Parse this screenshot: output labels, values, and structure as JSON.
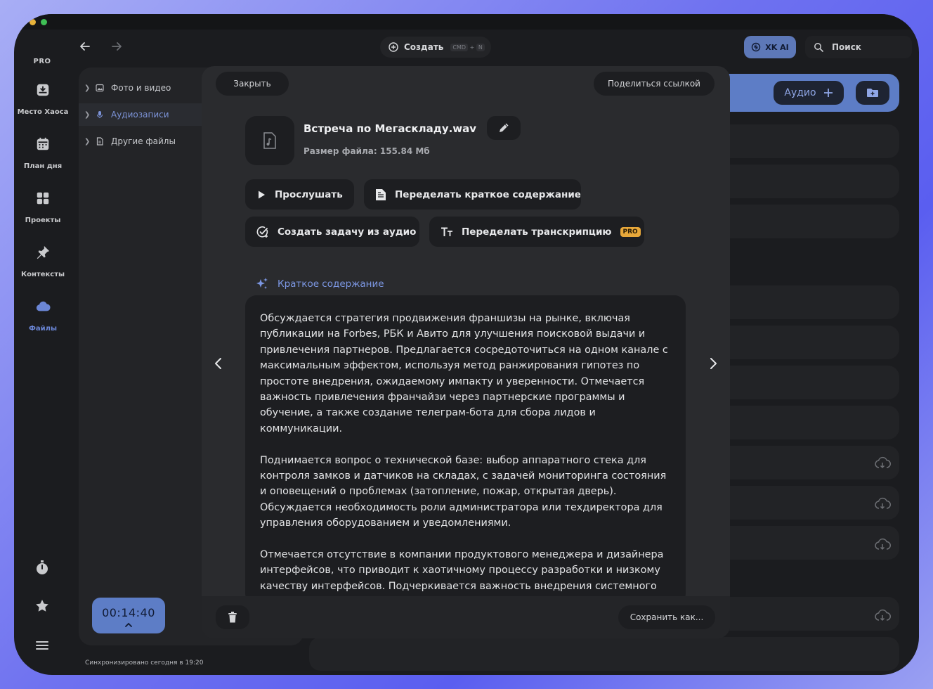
{
  "app": {
    "plan_label": "PRO",
    "nav": [
      {
        "label": "Место Хаоса",
        "icon": "inbox-tray-icon"
      },
      {
        "label": "План дня",
        "icon": "calendar-icon"
      },
      {
        "label": "Проекты",
        "icon": "grid-icon"
      },
      {
        "label": "Контексты",
        "icon": "pin-icon"
      },
      {
        "label": "Файлы",
        "icon": "cloud-icon",
        "active": true
      }
    ],
    "bottom_icons": [
      "stopwatch-icon",
      "star-icon",
      "menu-icon"
    ]
  },
  "topbar": {
    "create_label": "Создать",
    "shortcut": [
      "CMD",
      "+",
      "N"
    ],
    "ai_label": "XK AI",
    "search_placeholder": "Поиск"
  },
  "tree": {
    "items": [
      {
        "label": "Фото и видео",
        "icon": "image-icon"
      },
      {
        "label": "Аудиозаписи",
        "icon": "microphone-icon",
        "active": true
      },
      {
        "label": "Другие файлы",
        "icon": "document-icon"
      }
    ]
  },
  "list": {
    "audio_button": "Аудио"
  },
  "timer": {
    "value": "00:14:40"
  },
  "status": {
    "sync_text": "Синхронизировано сегодня в 19:20"
  },
  "modal": {
    "close_label": "Закрыть",
    "share_label": "Поделиться ссылкой",
    "file": {
      "name": "Встреча по Мегаскладу.wav",
      "size": "Размер файла: 155.84 Мб"
    },
    "actions": {
      "listen": "Прослушать",
      "redo_summary": "Переделать краткое содержание",
      "create_task": "Создать задачу из аудио",
      "redo_transcript": "Переделать транскрипцию",
      "pro_badge": "PRO"
    },
    "summary_title": "Краткое содержание",
    "summary_paragraphs": [
      "Обсуждается стратегия продвижения франшизы на рынке, включая публикации на Forbes, РБК и Авито для улучшения поисковой выдачи и привлечения партнеров. Предлагается сосредоточиться на одном канале с максимальным эффектом, используя метод ранжирования гипотез по простоте внедрения, ожидаемому импакту и уверенности. Отмечается важность привлечения франчайзи через партнерские программы и обучение, а также создание телеграм-бота для сбора лидов и коммуникации.",
      "Поднимается вопрос о технической базе: выбор аппаратного стека для контроля замков и датчиков на складах, с задачей мониторинга состояния и оповещений о проблемах (затопление, пожар, открытая дверь). Обсуждается необходимость роли администратора или техдиректора для управления оборудованием и уведомлениями.",
      "Отмечается отсутствие в компании продуктового менеджера и дизайнера интерфейсов, что приводит к хаотичному процессу разработки и низкому качеству интерфейсов. Подчеркивается важность внедрения системного подхода к постановке задач, приоритизации и"
    ],
    "save_label": "Сохранить как..."
  }
}
